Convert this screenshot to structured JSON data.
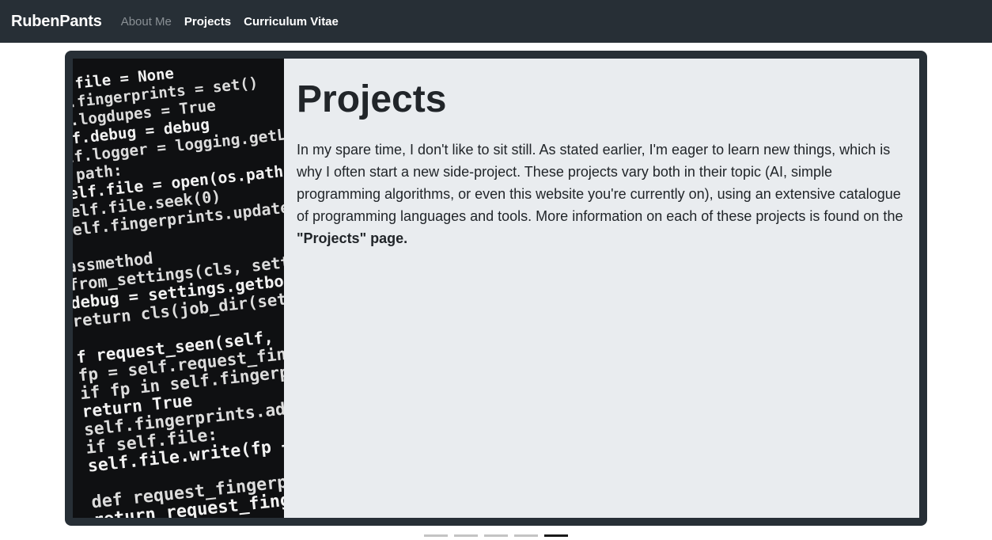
{
  "navbar": {
    "brand": "RubenPants",
    "links": [
      {
        "label": "About Me",
        "active": false
      },
      {
        "label": "Projects",
        "active": true
      },
      {
        "label": "Curriculum Vitae",
        "active": true
      }
    ]
  },
  "slide": {
    "title": "Projects",
    "body_text": "In my spare time, I don't like to sit still. As stated earlier, I'm eager to learn new things, which is why I often start a new side-project. These projects vary both in their topic (AI, simple programming algorithms, or even this website you're currently on), using an extensive catalogue of programming languages and tools. More information on each of these projects is found on the ",
    "link_text": "\"Projects\" page.",
    "image_code_lines": [
      "if.file = None",
      "lf.fingerprints = set()",
      "lf.logdupes = True",
      "elf.debug = debug",
      "elf.logger = logging.getLogg",
      "f path:",
      "    self.file = open(os.path",
      "    self.file.seek(0)",
      "    self.fingerprints.update",
      "",
      "assmethod",
      " from_settings(cls, settings",
      " debug = settings.getbool('",
      " return cls(job_dir(setting",
      "",
      "f request_seen(self, request",
      "  fp = self.request_fingerpr",
      "  if fp in self.fingerprint",
      "      return True",
      "  self.fingerprints.add(fp)",
      "  if self.file:",
      "      self.file.write(fp +",
      "",
      "def request_fingerprint(self",
      "    return request_fingerpr"
    ]
  },
  "carousel": {
    "indicator_count": 5,
    "active_index": 4
  }
}
